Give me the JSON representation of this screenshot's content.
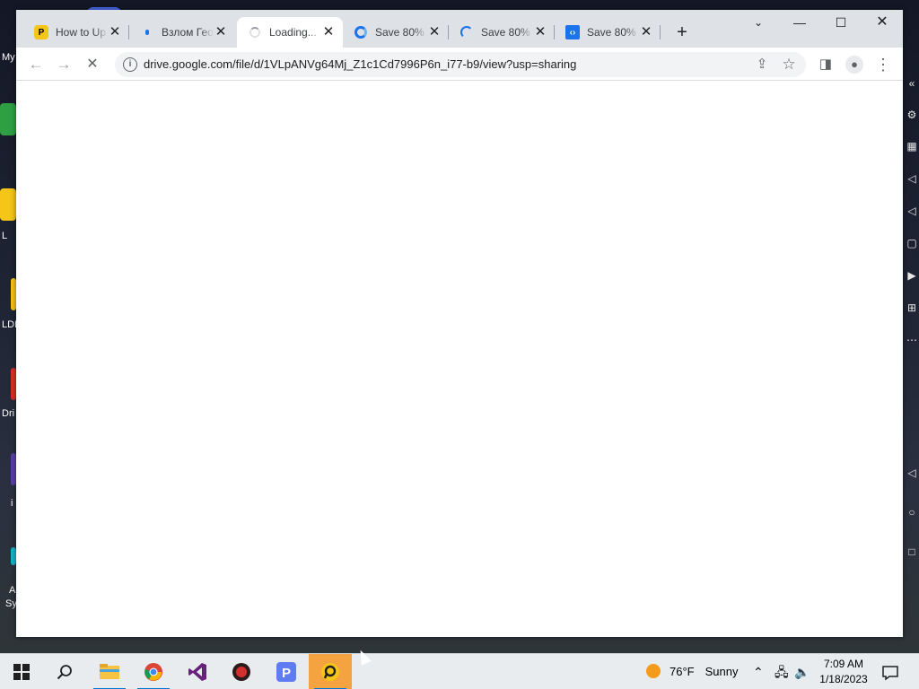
{
  "desktop": {
    "icon_labels": [
      "My",
      "L",
      "LDI",
      "Dri",
      "i",
      "A",
      "Sy"
    ]
  },
  "browser": {
    "tabs": [
      {
        "title": "How to Up",
        "favicon": "yellow-p-icon",
        "active": false
      },
      {
        "title": "Взлом Гео",
        "favicon": "blue-dot-icon",
        "active": false
      },
      {
        "title": "Loading...",
        "favicon": "spinner-icon",
        "active": true
      },
      {
        "title": "Save 80%",
        "favicon": "edge-swirl-icon",
        "active": false
      },
      {
        "title": "Save 80%",
        "favicon": "spinner-icon",
        "active": false
      },
      {
        "title": "Save 80%",
        "favicon": "blue-code-icon",
        "active": false
      }
    ],
    "new_tab_glyph": "+",
    "url": "drive.google.com/file/d/1VLpANVg64Mj_Z1c1Cd7996P6n_i77-b9/view?usp=sharing"
  },
  "taskbar": {
    "weather_temp": "76°F",
    "weather_desc": "Sunny",
    "time": "7:09 AM",
    "date": "1/18/2023"
  },
  "colors": {
    "accent": "#1a73e8",
    "tabstrip": "#dee1e6",
    "taskbar_highlight": "#f4a340"
  }
}
